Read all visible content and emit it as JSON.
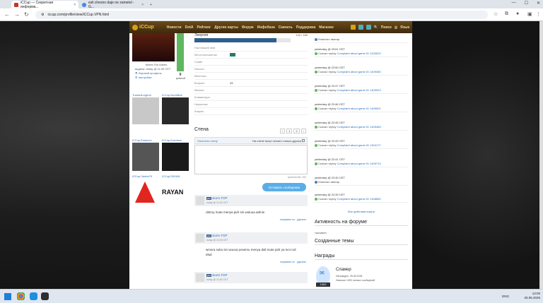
{
  "browser": {
    "tabs": [
      {
        "title": "iCCup — Секретная информа..."
      },
      {
        "title": "esli chesno daje ne zametel - G..."
      }
    ],
    "url": "iccup.com/profile/view/iCCup.VPN.html"
  },
  "site": {
    "logo": "iCCup",
    "menu": [
      "Новости",
      "DotA",
      "Рейтинг",
      "Другие карты",
      "Форум",
      "Инфобаза",
      "Скачать",
      "Поддержка",
      "Магазин"
    ],
    "search": "Поиск",
    "lang": "Язык"
  },
  "profile": {
    "name": "Mutes Full Admin",
    "seen": "видели: today @ 11:59 CET",
    "links": [
      "Игровой профиль",
      "настройки"
    ],
    "level": "9",
    "level_label": "ДОБРЫЙ",
    "level_fraction": 1.0,
    "energy_label": "Энергия",
    "energy_value": "140 / 165",
    "energy_fraction": 0.85,
    "fields": [
      {
        "label": "Настоящее имя",
        "value": ""
      },
      {
        "label": "Местоположение",
        "value": ""
      },
      {
        "label": "Скайп",
        "value": ""
      },
      {
        "label": "Discord",
        "value": ""
      },
      {
        "label": "ВКонтакт",
        "value": ""
      },
      {
        "label": "Возраст",
        "value": "33"
      },
      {
        "label": "Мышка",
        "value": ""
      },
      {
        "label": "Клавиатура",
        "value": ""
      },
      {
        "label": "Наушники",
        "value": ""
      },
      {
        "label": "Коврик",
        "value": ""
      }
    ],
    "friends": [
      {
        "name": "TrainedLegend"
      },
      {
        "name": "iCCup.NoobBee"
      },
      {
        "name": "iCCup.Essence"
      },
      {
        "name": "iCCup.Kondrew"
      },
      {
        "name": "iCCup.Sasha79"
      },
      {
        "name": "iCCup.RAYAN"
      }
    ],
    "rayan_logo": "RAYAN"
  },
  "wall": {
    "title": "Стена",
    "pages": [
      "1",
      "2"
    ],
    "clear": "Очистить стену",
    "notice": "На стене могут писать только друзья",
    "chars_left": "symbols left: 200",
    "send": "Оставить сообщение",
    "posts": [
      {
        "badge": "pro",
        "author": "storm.TOP",
        "date": "today @ 11:54 CET",
        "text": "obtroy mute menya pidr sin wuluua admin",
        "actions": "отправить пс · удалить"
      },
      {
        "badge": "pro",
        "author": "storm.TOP",
        "date": "today @ 11:53 CET",
        "text": "wmsra suka sin wuuxa posemu menya dali mute pidr ya tvoi rod ebal",
        "actions": "отправить пс · удалить"
      },
      {
        "badge": "pro",
        "author": "storm.TOP",
        "date": "today @ 11:52 CET",
        "text": "",
        "actions": ""
      }
    ]
  },
  "events": {
    "top": "Изменил аватар",
    "items": [
      {
        "date": "yesterday @ 23:51 CET",
        "text": "Скачал replay",
        "link": "Complaint about game ID 1433520"
      },
      {
        "date": "yesterday @ 22:50 CET",
        "text": "Скачал replay",
        "link": "Complaint about game ID 1409380"
      },
      {
        "date": "yesterday @ 22:47 CET",
        "text": "Скачал replay",
        "link": "Complaint about game ID 1409523"
      },
      {
        "date": "yesterday @ 22:46 CET",
        "text": "Скачал replay",
        "link": "Complaint about game ID 1409501"
      },
      {
        "date": "yesterday @ 22:45 CET",
        "text": "Скачал replay",
        "link": "Complaint about game ID 1409489"
      },
      {
        "date": "yesterday @ 22:43 CET",
        "text": "Скачал replay",
        "link": "Complaint about game ID 1404177"
      },
      {
        "date": "yesterday @ 22:41 CET",
        "text": "Скачал replay",
        "link": "Complaint about game ID 1409710"
      },
      {
        "date": "yesterday @ 22:40 CET",
        "text": "Изменил аватар",
        "link": ""
      },
      {
        "date": "yesterday @ 22:39 CET",
        "text": "Скачал replay",
        "link": "Complaint about game ID 1408882"
      }
    ],
    "all": "Все действия юзера"
  },
  "forum": {
    "title": "Активность на форуме",
    "sub": "тассивен"
  },
  "topics": {
    "title": "Созданные темы"
  },
  "awards": {
    "title": "Награды",
    "name": "Спамер",
    "line1": "Награжден: 25.05.2026",
    "line2": "Написал 1000 личных сообщений",
    "badge": "1000"
  },
  "taskbar": {
    "lang": "ENG",
    "time": "13:00",
    "date": "26.05.2026"
  }
}
